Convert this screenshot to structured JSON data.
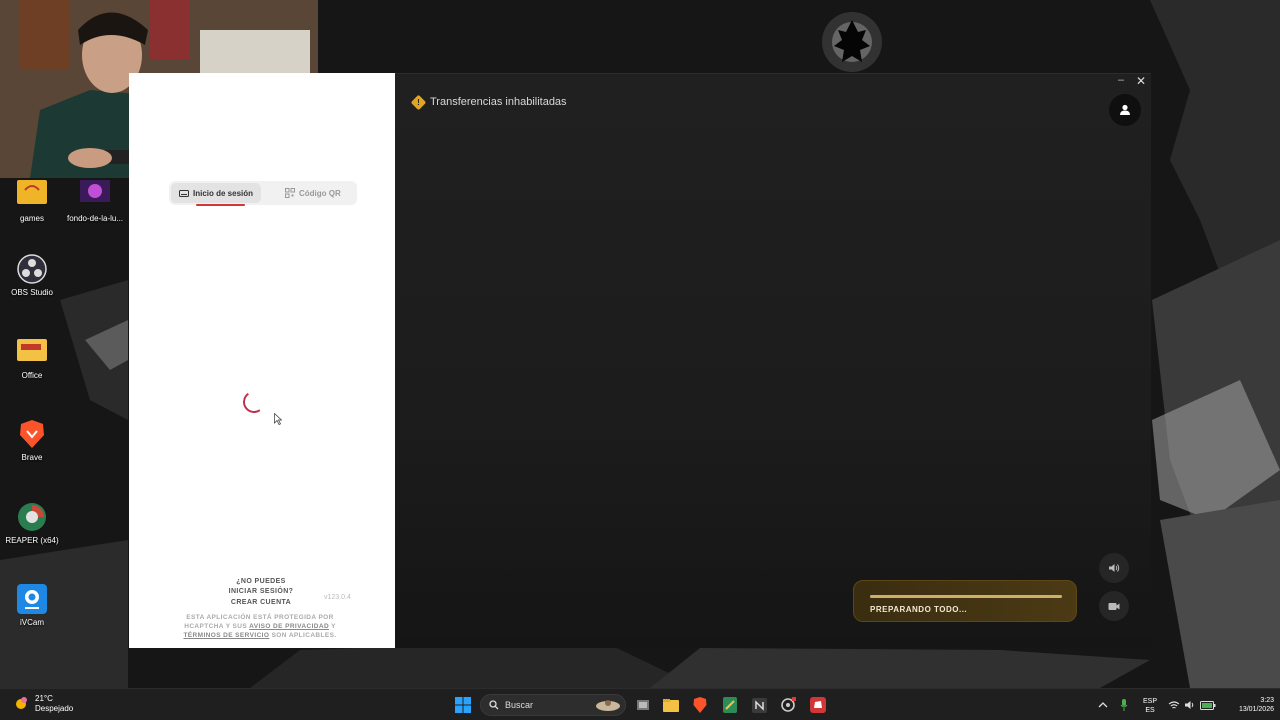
{
  "desktop": {
    "icons": [
      {
        "label": "games"
      },
      {
        "label": "fondo-de-la-lu..."
      },
      {
        "label": "OBS Studio"
      },
      {
        "label": "Office"
      },
      {
        "label": "Brave"
      },
      {
        "label": "REAPER (x64)"
      },
      {
        "label": "iVCam"
      }
    ]
  },
  "login": {
    "tabs": [
      {
        "label": "Inicio de sesión",
        "icon": "keyboard-icon"
      },
      {
        "label": "Código QR",
        "icon": "qr-code-icon"
      }
    ],
    "cant_login": "¿NO PUEDES INICIAR SESIÓN?",
    "create_account": "CREAR CUENTA",
    "version": "v123.0.4",
    "legal_pre": "ESTA APLICACIÓN ESTÁ PROTEGIDA POR HCAPTCHA Y SUS",
    "legal_privacy": "AVISO DE PRIVACIDAD",
    "legal_and": "Y",
    "legal_terms": "TÉRMINOS DE SERVICIO",
    "legal_post": "SON APLICABLES.",
    "accent_color": "#d13639"
  },
  "main": {
    "warning_text": "Transferencias inhabilitadas",
    "warning_color": "#e3a51d",
    "progress_label": "PREPARANDO TODO...",
    "progress_fraction": 1.0
  },
  "taskbar": {
    "weather_temp": "21°C",
    "weather_desc": "Despejado",
    "search_placeholder": "Buscar",
    "lang_top": "ESP",
    "lang_bottom": "ES",
    "time": "3:23",
    "date": "13/01/2026"
  }
}
